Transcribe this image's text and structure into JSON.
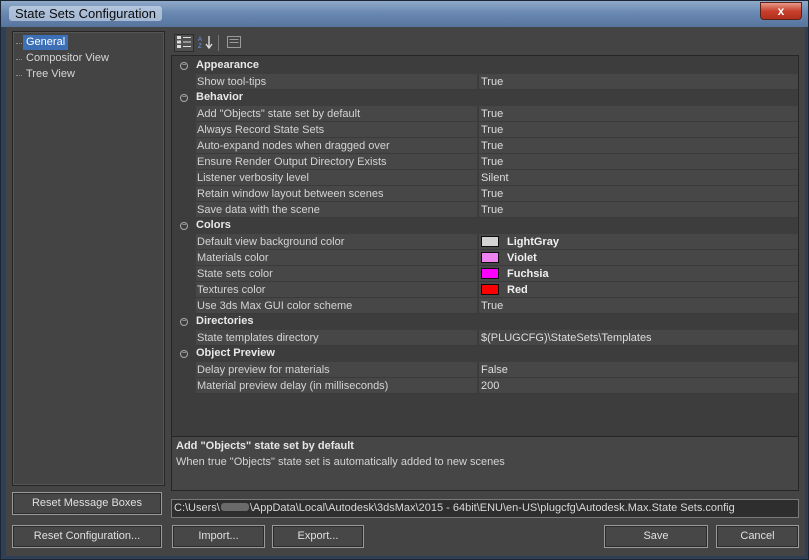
{
  "window": {
    "title": "State Sets Configuration",
    "close_glyph": "x"
  },
  "tree": {
    "items": [
      {
        "label": "General",
        "selected": true
      },
      {
        "label": "Compositor View",
        "selected": false
      },
      {
        "label": "Tree View",
        "selected": false
      }
    ]
  },
  "toolbar": {
    "categorized_icon": "categorized-view-icon",
    "alphabetical_icon": "alphabetical-sort-icon",
    "property_pages_icon": "property-pages-icon"
  },
  "grid": {
    "rows": [
      {
        "type": "category",
        "label": "Appearance"
      },
      {
        "type": "prop",
        "name": "Show tool-tips",
        "value": "True"
      },
      {
        "type": "category",
        "label": "Behavior"
      },
      {
        "type": "prop",
        "name": "Add \"Objects\" state set by default",
        "value": "True"
      },
      {
        "type": "prop",
        "name": "Always Record State Sets",
        "value": "True"
      },
      {
        "type": "prop",
        "name": "Auto-expand nodes when dragged over",
        "value": "True"
      },
      {
        "type": "prop",
        "name": "Ensure Render Output Directory Exists",
        "value": "True"
      },
      {
        "type": "prop",
        "name": "Listener verbosity level",
        "value": "Silent"
      },
      {
        "type": "prop",
        "name": "Retain window layout between scenes",
        "value": "True"
      },
      {
        "type": "prop",
        "name": "Save data with the scene",
        "value": "True"
      },
      {
        "type": "category",
        "label": "Colors"
      },
      {
        "type": "color",
        "name": "Default view background color",
        "value": "LightGray",
        "color": "#d3d3d3"
      },
      {
        "type": "color",
        "name": "Materials color",
        "value": "Violet",
        "color": "#ee82ee"
      },
      {
        "type": "color",
        "name": "State sets color",
        "value": "Fuchsia",
        "color": "#ff00ff"
      },
      {
        "type": "color",
        "name": "Textures color",
        "value": "Red",
        "color": "#ff0000"
      },
      {
        "type": "prop",
        "name": "Use 3ds Max GUI color scheme",
        "value": "True"
      },
      {
        "type": "category",
        "label": "Directories"
      },
      {
        "type": "prop",
        "name": "State templates directory",
        "value": "$(PLUGCFG)\\StateSets\\Templates"
      },
      {
        "type": "category",
        "label": "Object Preview"
      },
      {
        "type": "prop",
        "name": "Delay preview for materials",
        "value": "False"
      },
      {
        "type": "prop",
        "name": "Material preview delay (in milliseconds)",
        "value": "200"
      }
    ]
  },
  "description": {
    "title": "Add \"Objects\" state set by default",
    "body": "When true \"Objects\" state set is automatically added to new scenes"
  },
  "config_path": {
    "prefix": "C:\\Users\\",
    "suffix": "\\AppData\\Local\\Autodesk\\3dsMax\\2015 - 64bit\\ENU\\en-US\\plugcfg\\Autodesk.Max.State Sets.config"
  },
  "buttons": {
    "reset_message_boxes": "Reset Message Boxes",
    "reset_configuration": "Reset Configuration...",
    "import": "Import...",
    "export": "Export...",
    "save": "Save",
    "cancel": "Cancel"
  }
}
